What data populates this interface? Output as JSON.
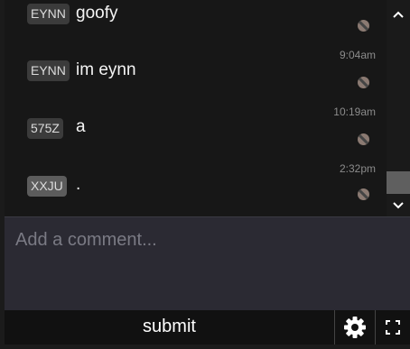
{
  "messages": [
    {
      "tag": "EYNN",
      "text": "goofy",
      "time": ""
    },
    {
      "tag": "EYNN",
      "text": "im eynn",
      "time": "9:04am"
    },
    {
      "tag": "575Z",
      "text": "a",
      "time": "10:19am"
    },
    {
      "tag": "XXJU",
      "text": ".",
      "time": "2:32pm"
    }
  ],
  "comment": {
    "placeholder": "Add a comment..."
  },
  "toolbar": {
    "submit_label": "submit"
  },
  "icons": {
    "scroll_up": "chevron-up-icon",
    "scroll_down": "chevron-down-icon",
    "ban": "ban-icon",
    "settings": "gear-icon",
    "fullscreen": "fullscreen-icon"
  },
  "colors": {
    "tag_bg": "#3b3b3b",
    "tag_selected_bg": "#5c5c5c",
    "input_bg": "#2b2a33"
  }
}
